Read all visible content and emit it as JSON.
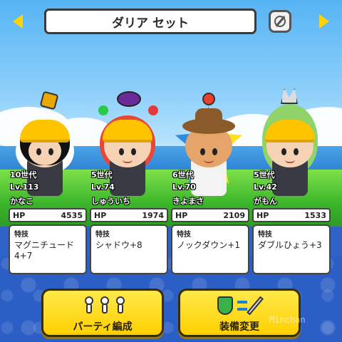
{
  "set_title": "ダリア セット",
  "colors": {
    "accent_yellow": "#ffd400",
    "hat_yellow": "#ffc400",
    "panel_bg": "#ffffff",
    "lower_bg": "#2c5fc5"
  },
  "characters": [
    {
      "gen": "10世代",
      "level": "Lv.113",
      "name": "かなこ",
      "hp_label": "HP",
      "hp": "4535",
      "skill_label": "特技",
      "skill": "マグニチュード4+7"
    },
    {
      "gen": "5世代",
      "level": "Lv.74",
      "name": "しゅういち",
      "hp_label": "HP",
      "hp": "1974",
      "skill_label": "特技",
      "skill": "シャドウ+8"
    },
    {
      "gen": "6世代",
      "level": "Lv.70",
      "name": "きよまさ",
      "hp_label": "HP",
      "hp": "2109",
      "skill_label": "特技",
      "skill": "ノックダウン+1"
    },
    {
      "gen": "5世代",
      "level": "Lv.42",
      "name": "がもん",
      "hp_label": "HP",
      "hp": "1533",
      "skill_label": "特技",
      "skill": "ダブルひょう+3"
    }
  ],
  "buttons": {
    "party": "パーティ編成",
    "equip": "装備変更"
  },
  "watermark": "Minchan"
}
